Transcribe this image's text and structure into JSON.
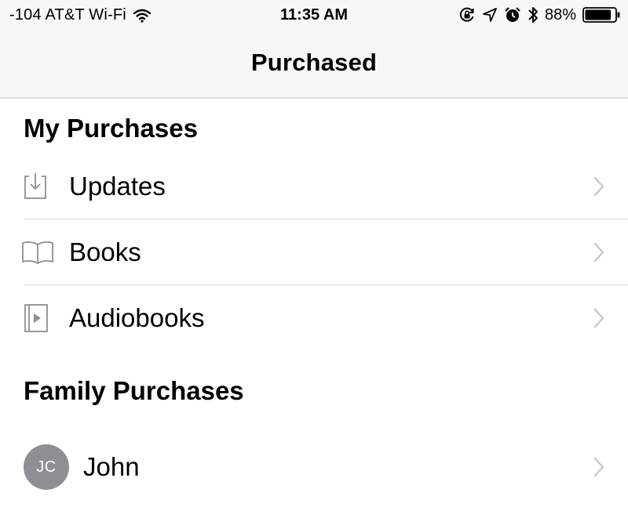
{
  "status_bar": {
    "carrier": "-104 AT&T Wi-Fi",
    "time": "11:35 AM",
    "battery_percent": "88%",
    "battery_level": 0.88,
    "icons": [
      "wifi-icon",
      "orientation-lock-icon",
      "location-icon",
      "alarm-icon",
      "bluetooth-icon",
      "battery-icon"
    ]
  },
  "nav": {
    "title": "Purchased"
  },
  "my_purchases": {
    "header": "My Purchases",
    "items": [
      {
        "label": "Updates",
        "icon": "download-tray-icon"
      },
      {
        "label": "Books",
        "icon": "open-book-icon"
      },
      {
        "label": "Audiobooks",
        "icon": "audiobook-icon"
      }
    ]
  },
  "family_purchases": {
    "header": "Family Purchases",
    "members": [
      {
        "initials": "JC",
        "name": "John"
      }
    ]
  },
  "colors": {
    "bar_background": "#f7f7f7",
    "separator": "#d6d6d6",
    "chevron": "#c7c7cc",
    "avatar": "#8e8e93",
    "icon_stroke": "#8e8e93"
  }
}
